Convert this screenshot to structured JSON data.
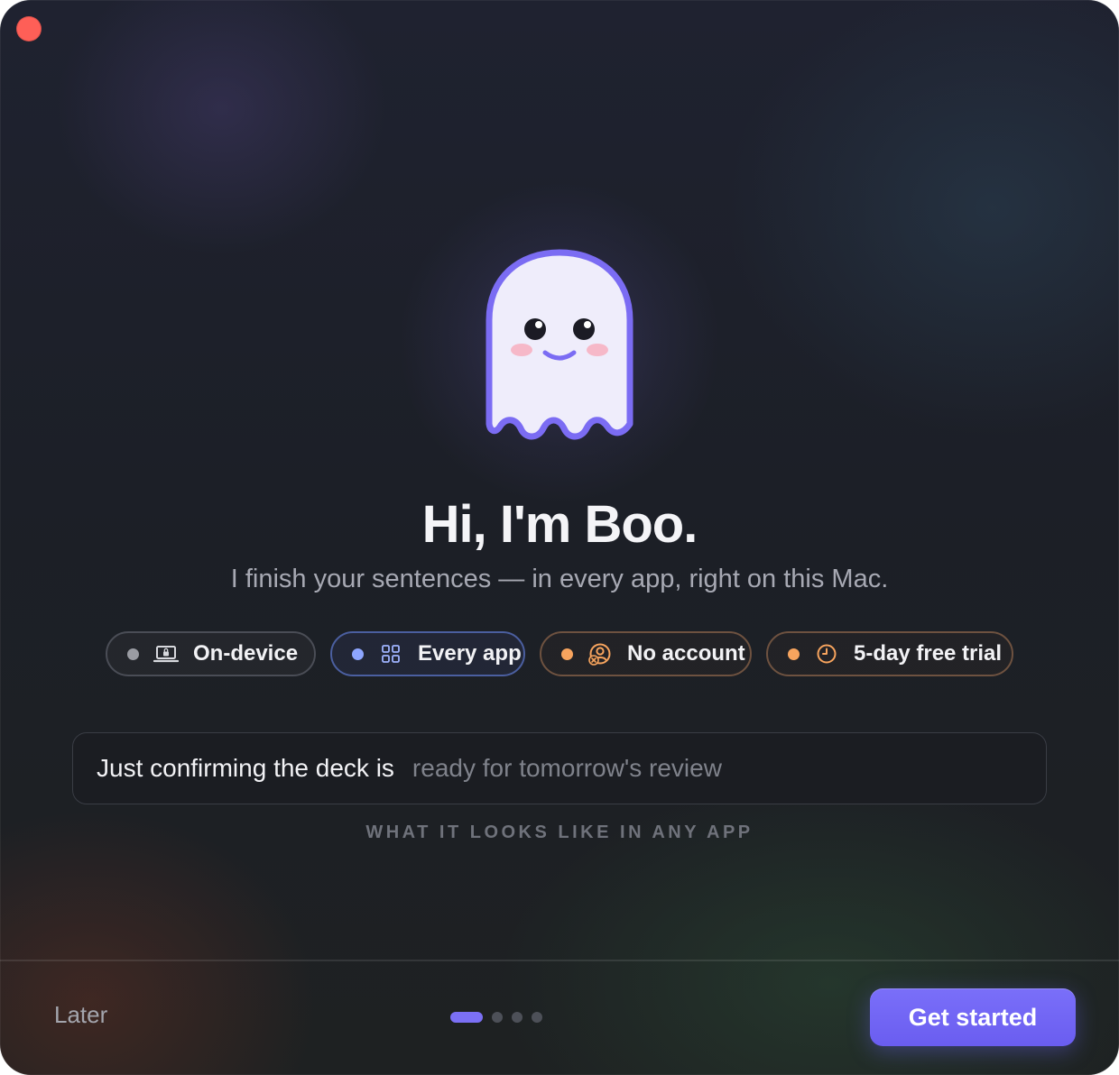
{
  "window": {
    "close_button": "close"
  },
  "hero": {
    "mascot_icon": "ghost-icon",
    "title": "Hi, I'm Boo.",
    "subtitle": "I finish your sentences — in every app, right on this Mac."
  },
  "features": [
    {
      "label": "On-device",
      "icon": "laptop-lock-icon",
      "accent": "#9a9ca3"
    },
    {
      "label": "Every app",
      "icon": "grid-icon",
      "accent": "#8ea6ff"
    },
    {
      "label": "No account",
      "icon": "no-user-icon",
      "accent": "#f7a45e"
    },
    {
      "label": "5-day free trial",
      "icon": "clock-icon",
      "accent": "#f7a45e"
    }
  ],
  "demo": {
    "typed_text": "Just confirming the deck is",
    "suggestion_text": "ready for tomorrow's review",
    "caption": "WHAT IT LOOKS LIKE IN ANY APP"
  },
  "footer": {
    "later_label": "Later",
    "pager": {
      "current": 1,
      "total": 4
    },
    "cta_label": "Get started"
  },
  "colors": {
    "accent": "#6a5df0",
    "close": "#fe5f57"
  }
}
